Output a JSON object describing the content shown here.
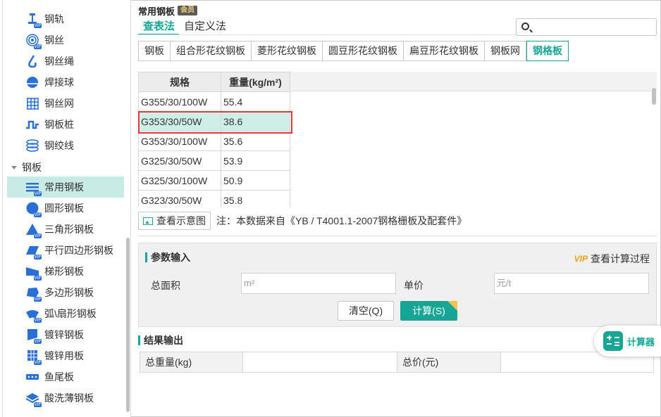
{
  "sidebar": {
    "items_top": [
      {
        "label": "钢轨",
        "icon": "rail-icon"
      },
      {
        "label": "钢丝",
        "icon": "wire-icon"
      },
      {
        "label": "钢丝绳",
        "icon": "wire-rope-icon"
      },
      {
        "label": "焊接球",
        "icon": "weld-ball-icon"
      },
      {
        "label": "钢丝网",
        "icon": "wire-mesh-icon"
      },
      {
        "label": "钢板桩",
        "icon": "sheet-pile-icon"
      },
      {
        "label": "钢绞线",
        "icon": "strand-icon"
      }
    ],
    "group_label": "钢板",
    "items_group": [
      {
        "label": "常用钢板",
        "icon": "common-plate-icon"
      },
      {
        "label": "圆形钢板",
        "icon": "round-plate-icon"
      },
      {
        "label": "三角形钢板",
        "icon": "triangle-plate-icon"
      },
      {
        "label": "平行四边形钢板",
        "icon": "parallelogram-plate-icon"
      },
      {
        "label": "梯形钢板",
        "icon": "trapezoid-plate-icon"
      },
      {
        "label": "多边形钢板",
        "icon": "polygon-plate-icon"
      },
      {
        "label": "弧\\扇形钢板",
        "icon": "sector-plate-icon"
      },
      {
        "label": "镀锌钢板",
        "icon": "galvanized-plate-icon"
      },
      {
        "label": "镀锌用板",
        "icon": "galvanized-board-icon"
      },
      {
        "label": "鱼尾板",
        "icon": "fishplate-icon"
      },
      {
        "label": "酸洗薄钢板",
        "icon": "pickled-plate-icon"
      }
    ],
    "vip_label": "VIP"
  },
  "header": {
    "title": "常用钢板",
    "badge": "会员",
    "mode_tabs": [
      {
        "label": "查表法",
        "active": true
      },
      {
        "label": "自定义法",
        "active": false
      }
    ]
  },
  "category_tabs": [
    {
      "label": "钢板",
      "active": false
    },
    {
      "label": "组合形花纹钢板",
      "active": false
    },
    {
      "label": "菱形花纹钢板",
      "active": false
    },
    {
      "label": "圆豆形花纹钢板",
      "active": false
    },
    {
      "label": "扁豆形花纹钢板",
      "active": false
    },
    {
      "label": "钢板网",
      "active": false
    },
    {
      "label": "钢格板",
      "active": true
    }
  ],
  "table": {
    "headers": [
      "规格",
      "重量(kg/m²)"
    ],
    "rows": [
      [
        "G355/30/100W",
        "55.4"
      ],
      [
        "G353/30/50W",
        "38.6"
      ],
      [
        "G353/30/100W",
        "35.6"
      ],
      [
        "G325/30/50W",
        "53.9"
      ],
      [
        "G325/30/100W",
        "50.9"
      ],
      [
        "G323/30/50W",
        "35.8"
      ]
    ],
    "selected_row": 1
  },
  "diagram_button": "查看示意图",
  "note": "注：本数据来自《YB / T4001.1-2007钢格栅板及配套件》",
  "params": {
    "title": "参数输入",
    "view_process": "查看计算过程",
    "vip_mark": "VIP",
    "total_area_label": "总面积",
    "total_area_placeholder": "m²",
    "unit_price_label": "单价",
    "unit_price_placeholder": "元/t",
    "clear_button": "清空(Q)",
    "calc_button": "计算(S)"
  },
  "results": {
    "title": "结果输出",
    "total_weight_label": "总重量(kg)",
    "total_weight_value": "",
    "total_price_label": "总价(元)",
    "total_price_value": ""
  },
  "calculator": {
    "label": "计算器"
  },
  "colors": {
    "accent": "#17a596",
    "highlight": "#e2383a",
    "selected_bg": "#c8ece5"
  }
}
